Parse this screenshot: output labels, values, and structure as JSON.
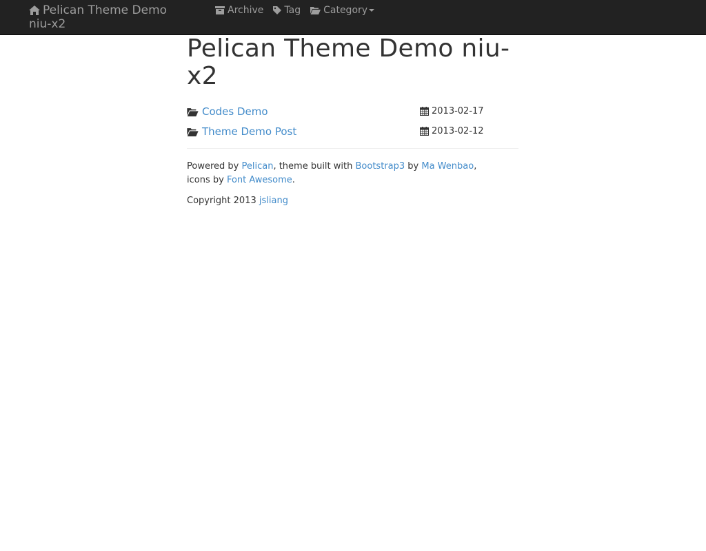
{
  "navbar": {
    "brand_line1": "Pelican Theme Demo",
    "brand_line2": "niu-x2",
    "brand_icon": "home-icon",
    "items": [
      {
        "label": "Archive",
        "icon": "archive-icon"
      },
      {
        "label": "Tag",
        "icon": "tag-icon"
      },
      {
        "label": "Category",
        "icon": "folder-open-icon"
      }
    ]
  },
  "main": {
    "title": "Pelican Theme Demo niu-x2",
    "posts": [
      {
        "title": "Codes Demo",
        "date": "2013-02-17"
      },
      {
        "title": "Theme Demo Post",
        "date": "2013-02-12"
      }
    ]
  },
  "footer": {
    "powered_by": "Powered by ",
    "pelican": "Pelican",
    "theme_built_with": ", theme built with ",
    "bootstrap": "Bootstrap3",
    "by": " by ",
    "author": "Ma Wenbao",
    "comma": ",",
    "icons_by": "icons by ",
    "font_awesome": "Font Awesome",
    "period": ".",
    "copyright": "Copyright 2013 ",
    "owner": "jsliang"
  },
  "colors": {
    "navbar_bg": "#222222",
    "navbar_text": "#9d9d9d",
    "link": "#428bca",
    "text": "#333333"
  }
}
